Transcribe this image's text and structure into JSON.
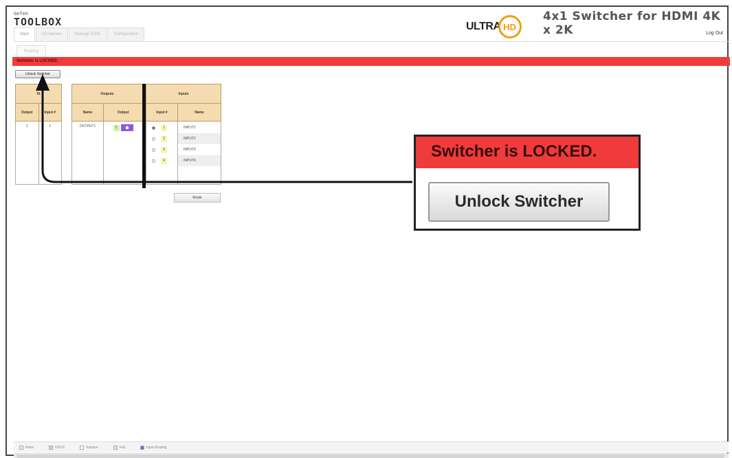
{
  "header": {
    "brand_small": "Gefen",
    "brand": "TOOLBOX",
    "ultra_text": "ULTRA",
    "hd_text": "HD",
    "device_title": "4x1 Switcher for HDMI 4K x 2K",
    "logout": "Log Out"
  },
  "tabs": [
    {
      "label": "Main"
    },
    {
      "label": "I/O Names"
    },
    {
      "label": "Manage EDID"
    },
    {
      "label": "Configuration"
    }
  ],
  "subtab": "Routing",
  "lock_bar": "Switcher is LOCKED.",
  "unlock_small": "Unlock Switcher",
  "status_table": {
    "title": "St",
    "col1": "Output",
    "col2": "Input #",
    "row": {
      "output": "1",
      "input": "1"
    }
  },
  "outputs_table": {
    "title": "Outputs",
    "col1": "Name",
    "col2": "Output",
    "row": {
      "name": "OUTPUT1",
      "num": "1"
    }
  },
  "inputs_table": {
    "title": "Inputs",
    "col1": "Input #",
    "col2": "Name",
    "rows": [
      {
        "num": "1",
        "name": "INPUT1"
      },
      {
        "num": "2",
        "name": "INPUT2"
      },
      {
        "num": "3",
        "name": "INPUT3"
      },
      {
        "num": "4",
        "name": "INPUT4"
      }
    ]
  },
  "route_button": "Route",
  "callout": {
    "text": "Switcher is LOCKED.",
    "button": "Unlock Switcher"
  },
  "legend": [
    {
      "label": "Index",
      "color": "#f7f3b0"
    },
    {
      "label": "HDCP",
      "color": "#bcd6f5"
    },
    {
      "label": "Inactive",
      "color": "#ffffff"
    },
    {
      "label": "Full",
      "color": "#f5dbb0"
    },
    {
      "label": "Input Routing",
      "color": "#8e5ad9"
    }
  ],
  "colors": {
    "locked_red": "#ef3b3b",
    "header_tan": "#f5dbb0",
    "accent_purple": "#8e5ad9"
  }
}
